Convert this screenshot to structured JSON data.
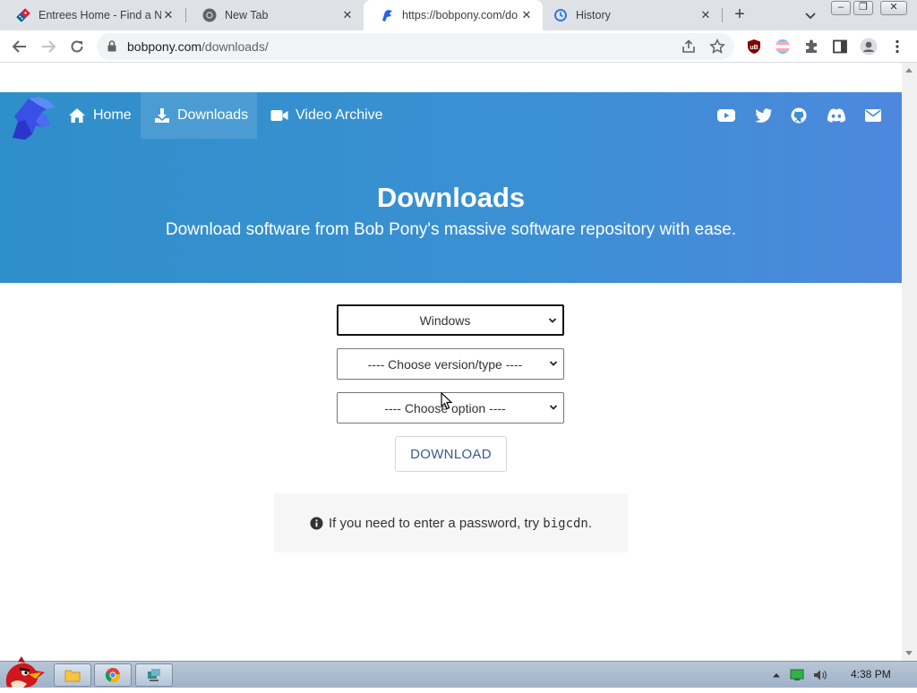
{
  "browser": {
    "tabs": [
      {
        "title": "Entrees Home - Find a Ne",
        "icon": "dominos-icon",
        "active": false
      },
      {
        "title": "New Tab",
        "icon": "chrome-icon",
        "active": false
      },
      {
        "title": "https://bobpony.com/do",
        "icon": "bobpony-icon",
        "active": true
      },
      {
        "title": "History",
        "icon": "history-icon",
        "active": false
      }
    ],
    "address": {
      "host": "bobpony.com",
      "path": "/downloads/"
    }
  },
  "site": {
    "nav": [
      {
        "label": "Home",
        "icon": "home-icon"
      },
      {
        "label": "Downloads",
        "icon": "download-icon",
        "active": true
      },
      {
        "label": "Video Archive",
        "icon": "video-icon"
      }
    ],
    "social": [
      "youtube-icon",
      "twitter-icon",
      "github-icon",
      "discord-icon",
      "email-icon"
    ],
    "hero": {
      "title": "Downloads",
      "subtitle": "Download software from Bob Pony's massive software repository with ease."
    },
    "form": {
      "os_select": "Windows",
      "version_select": "---- Choose version/type ----",
      "option_select": "---- Choose option ----",
      "download_label": "DOWNLOAD"
    },
    "notice": {
      "text": "If you need to enter a password, try",
      "code": "bigcdn",
      "end": "."
    }
  },
  "taskbar": {
    "time": "4:38 PM"
  },
  "colors": {
    "hero_start": "#2f8fc9",
    "hero_end": "#4d88dd",
    "tab_strip": "#dee1e6"
  }
}
